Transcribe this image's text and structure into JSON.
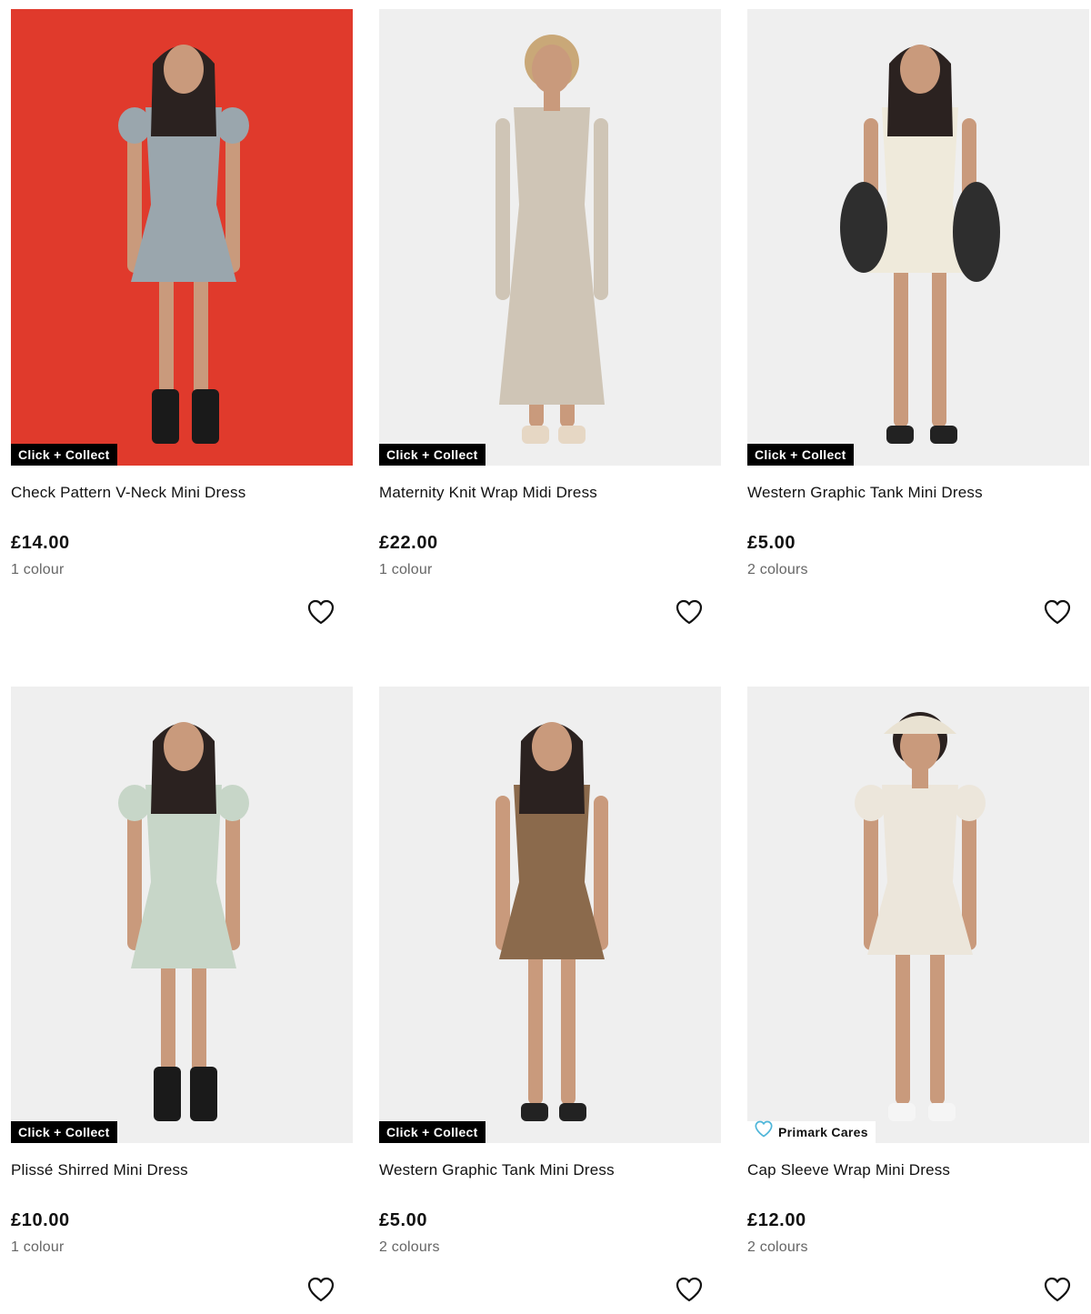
{
  "products": [
    {
      "name": "Check Pattern V-Neck Mini Dress",
      "price": "£14.00",
      "colours": "1 colour",
      "badge": "Click + Collect",
      "badge_type": "click-collect",
      "background_color": "#e03a2c",
      "dress_color": "#9aa6ad"
    },
    {
      "name": "Maternity Knit Wrap Midi Dress",
      "price": "£22.00",
      "colours": "1 colour",
      "badge": "Click + Collect",
      "badge_type": "click-collect",
      "background_color": "#efefef",
      "dress_color": "#cfc5b6"
    },
    {
      "name": "Western Graphic Tank Mini Dress",
      "price": "£5.00",
      "colours": "2 colours",
      "badge": "Click + Collect",
      "badge_type": "click-collect",
      "background_color": "#efefef",
      "dress_color": "#efeadb"
    },
    {
      "name": "Plissé Shirred Mini Dress",
      "price": "£10.00",
      "colours": "1 colour",
      "badge": "Click + Collect",
      "badge_type": "click-collect",
      "background_color": "#efefef",
      "dress_color": "#c7d6c8"
    },
    {
      "name": "Western Graphic Tank Mini Dress",
      "price": "£5.00",
      "colours": "2 colours",
      "badge": "Click + Collect",
      "badge_type": "click-collect",
      "background_color": "#efefef",
      "dress_color": "#8b6a4c"
    },
    {
      "name": "Cap Sleeve Wrap Mini Dress",
      "price": "£12.00",
      "colours": "2 colours",
      "badge": "Primark Cares",
      "badge_type": "primark-cares",
      "background_color": "#efefef",
      "dress_color": "#ece6db"
    }
  ],
  "colors": {
    "badge_background": "#000000",
    "badge_text": "#ffffff",
    "cares_heart": "#4fb6d9",
    "secondary_text": "#666666"
  },
  "icons": {
    "wishlist": "heart-outline-icon",
    "cares": "heart-outline-icon"
  }
}
